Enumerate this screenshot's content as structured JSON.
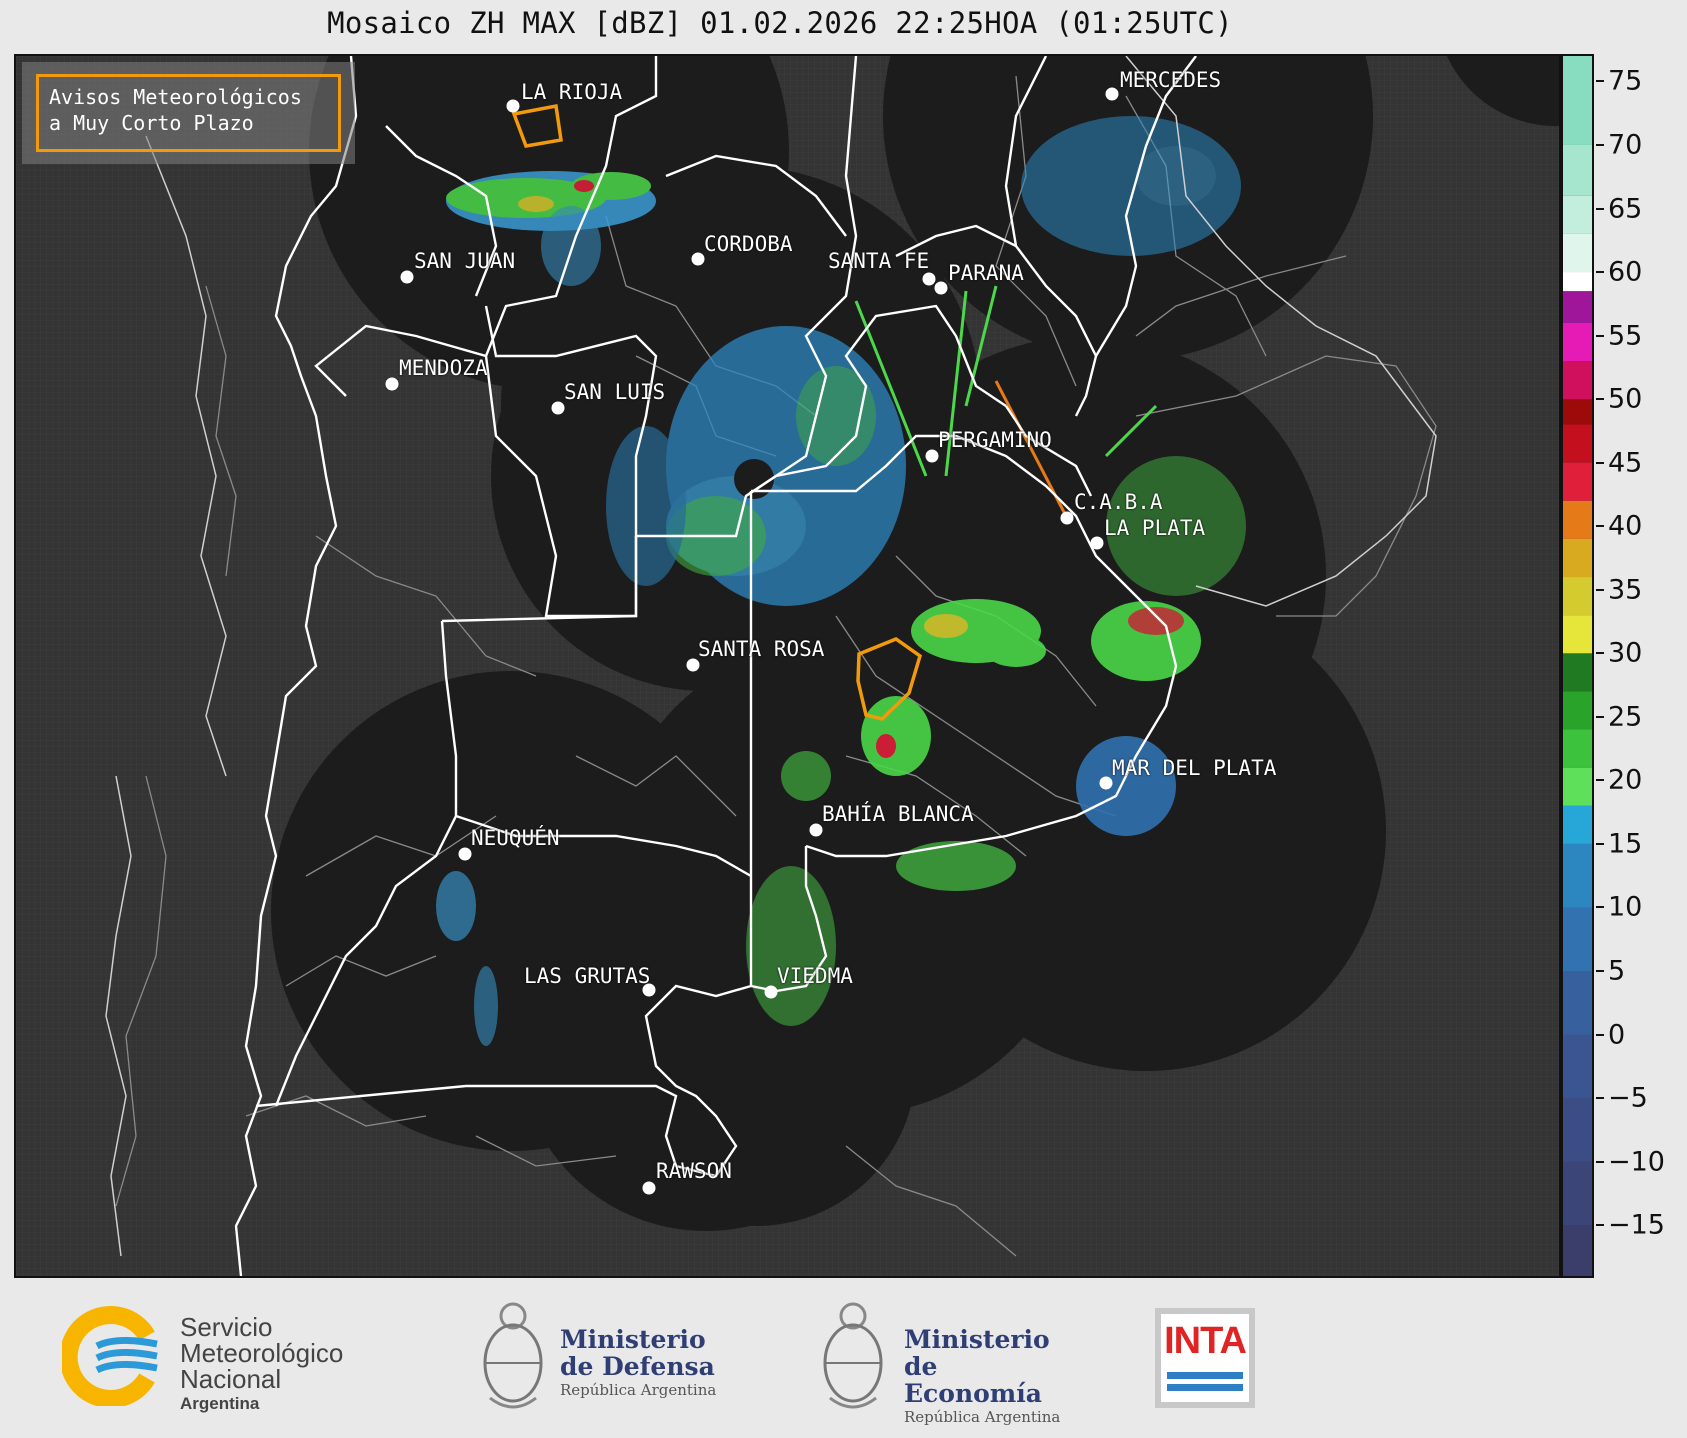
{
  "title": "Mosaico ZH MAX [dBZ] 01.02.2026 22:25HOA (01:25UTC)",
  "legend": {
    "line1": "Avisos Meteorológicos",
    "line2": "a Muy Corto Plazo",
    "border_color": "#f29a0c"
  },
  "colorbar": {
    "ticks": [
      "75",
      "70",
      "65",
      "60",
      "55",
      "50",
      "45",
      "40",
      "35",
      "30",
      "25",
      "20",
      "15",
      "10",
      "5",
      "0",
      "−5",
      "−10",
      "−15"
    ],
    "min": -19,
    "max": 77,
    "stops": [
      {
        "from": -19,
        "to": -15,
        "color": "#3b3d6b"
      },
      {
        "from": -15,
        "to": -10,
        "color": "#3b4577"
      },
      {
        "from": -10,
        "to": -5,
        "color": "#3b4d84"
      },
      {
        "from": -5,
        "to": 0,
        "color": "#3a5591"
      },
      {
        "from": 0,
        "to": 5,
        "color": "#37609f"
      },
      {
        "from": 5,
        "to": 10,
        "color": "#3272b0"
      },
      {
        "from": 10,
        "to": 15,
        "color": "#2c86c0"
      },
      {
        "from": 15,
        "to": 18,
        "color": "#27a6d8"
      },
      {
        "from": 18,
        "to": 21,
        "color": "#5ee05a"
      },
      {
        "from": 21,
        "to": 24,
        "color": "#3cc23c"
      },
      {
        "from": 24,
        "to": 27,
        "color": "#2aa32a"
      },
      {
        "from": 27,
        "to": 30,
        "color": "#1f7a22"
      },
      {
        "from": 30,
        "to": 33,
        "color": "#e6e63a"
      },
      {
        "from": 33,
        "to": 36,
        "color": "#d4cc2e"
      },
      {
        "from": 36,
        "to": 39,
        "color": "#d8aa20"
      },
      {
        "from": 39,
        "to": 42,
        "color": "#e57b18"
      },
      {
        "from": 42,
        "to": 45,
        "color": "#e0203a"
      },
      {
        "from": 45,
        "to": 48,
        "color": "#c4101e"
      },
      {
        "from": 48,
        "to": 50,
        "color": "#9c0a0a"
      },
      {
        "from": 50,
        "to": 53,
        "color": "#d0105c"
      },
      {
        "from": 53,
        "to": 56,
        "color": "#e61ab4"
      },
      {
        "from": 56,
        "to": 58.5,
        "color": "#a0169a"
      },
      {
        "from": 58.5,
        "to": 60,
        "color": "#ffffff"
      },
      {
        "from": 60,
        "to": 63,
        "color": "#e0f5ec"
      },
      {
        "from": 63,
        "to": 66,
        "color": "#c3eedd"
      },
      {
        "from": 66,
        "to": 70,
        "color": "#a6e6cf"
      },
      {
        "from": 70,
        "to": 77,
        "color": "#88dcbf"
      }
    ]
  },
  "cities": [
    {
      "name": "LA RIOJA"
    },
    {
      "name": "MERCEDES"
    },
    {
      "name": "CORDOBA"
    },
    {
      "name": "SAN JUAN"
    },
    {
      "name": "SANTA FE"
    },
    {
      "name": "PARANA"
    },
    {
      "name": "MENDOZA"
    },
    {
      "name": "SAN LUIS"
    },
    {
      "name": "PERGAMINO"
    },
    {
      "name": "C.A.B.A"
    },
    {
      "name": "LA PLATA"
    },
    {
      "name": "SANTA ROSA"
    },
    {
      "name": "MAR DEL PLATA"
    },
    {
      "name": "BAHÍA BLANCA"
    },
    {
      "name": "NEUQUÉN"
    },
    {
      "name": "LAS GRUTAS"
    },
    {
      "name": "VIEDMA"
    },
    {
      "name": "RAWSON"
    }
  ],
  "footer": {
    "smn": {
      "line1": "Servicio",
      "line2": "Meteorológico",
      "line3": "Nacional",
      "country": "Argentina"
    },
    "defensa": {
      "line1": "Ministerio",
      "line2": "de Defensa",
      "sub": "República Argentina"
    },
    "economia": {
      "line1": "Ministerio",
      "line2": "de Economía",
      "sub": "República Argentina"
    },
    "inta": {
      "word": "INTA"
    }
  }
}
